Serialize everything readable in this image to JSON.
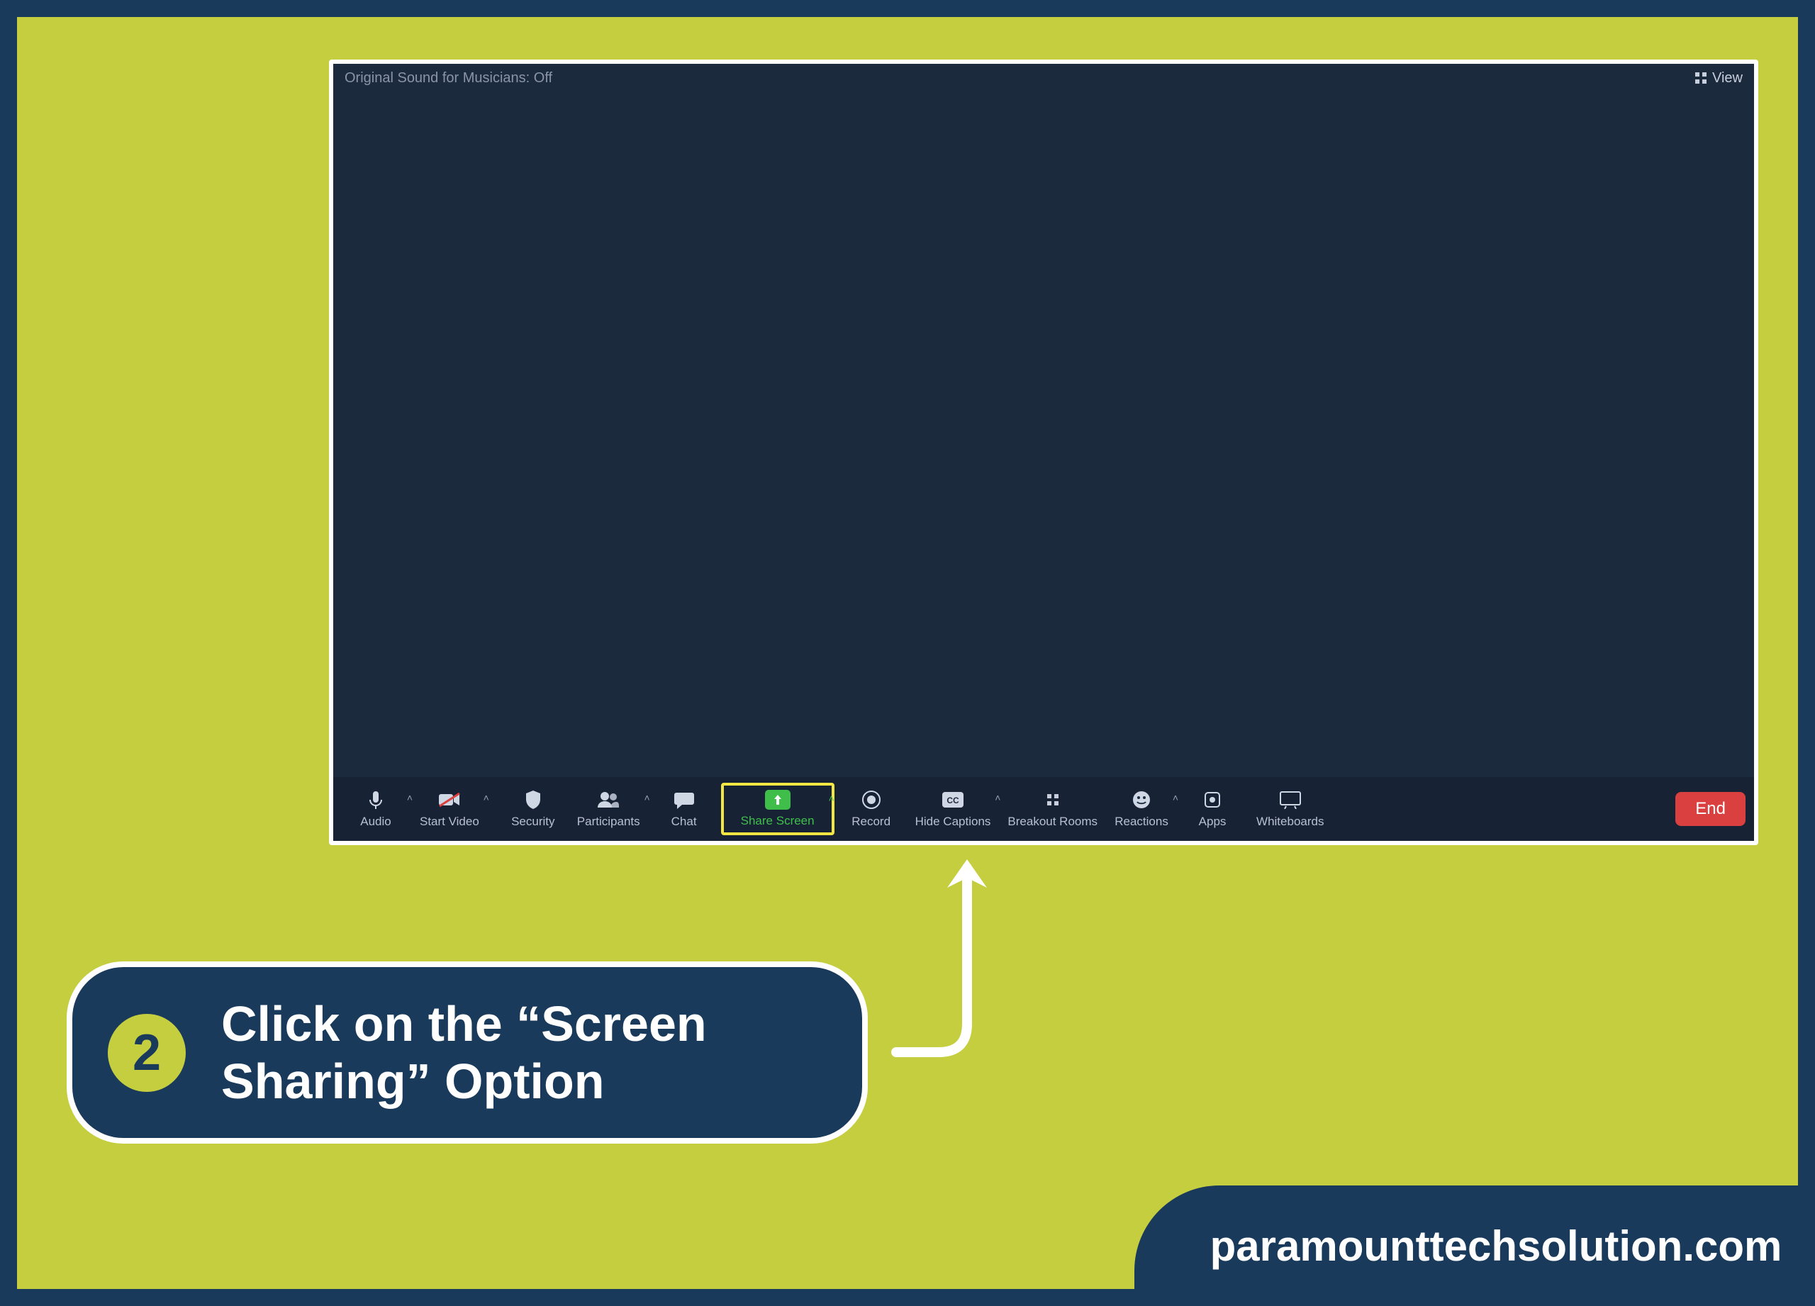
{
  "zoom": {
    "top_left_label": "Original Sound for Musicians: Off",
    "view_label": "View",
    "toolbar": {
      "audio": "Audio",
      "start_video": "Start Video",
      "security": "Security",
      "participants": "Participants",
      "chat": "Chat",
      "share_screen": "Share Screen",
      "record": "Record",
      "hide_captions": "Hide Captions",
      "breakout_rooms": "Breakout Rooms",
      "reactions": "Reactions",
      "apps": "Apps",
      "whiteboards": "Whiteboards",
      "end": "End"
    }
  },
  "instruction": {
    "step_number": "2",
    "text": "Click on the “Screen Sharing” Option"
  },
  "brand": "paramounttechsolution.com"
}
